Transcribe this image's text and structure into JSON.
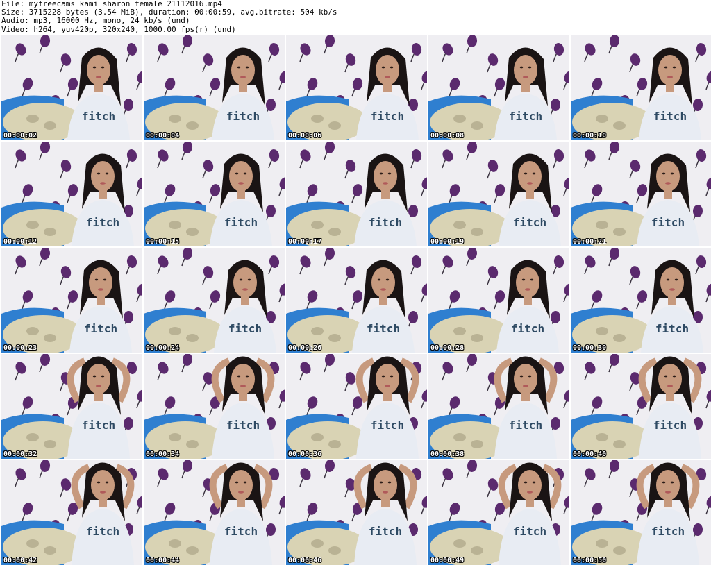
{
  "header": {
    "file": "File: myfreecams_kami_sharon_female_21112016.mp4",
    "size": "Size: 3715228 bytes (3.54 MiB), duration: 00:00:59, avg.bitrate: 504 kb/s",
    "audio": "Audio: mp3, 16000 Hz, mono, 24 kb/s (und)",
    "video": "Video: h264, yuv420p, 320x240, 1000.00 fps(r) (und)"
  },
  "thumbnails": [
    {
      "timestamp": "00:00:02"
    },
    {
      "timestamp": "00:00:04"
    },
    {
      "timestamp": "00:00:06"
    },
    {
      "timestamp": "00:00:08"
    },
    {
      "timestamp": "00:00:10"
    },
    {
      "timestamp": "00:00:12"
    },
    {
      "timestamp": "00:00:15"
    },
    {
      "timestamp": "00:00:17"
    },
    {
      "timestamp": "00:00:19"
    },
    {
      "timestamp": "00:00:21"
    },
    {
      "timestamp": "00:00:23"
    },
    {
      "timestamp": "00:00:24"
    },
    {
      "timestamp": "00:00:26"
    },
    {
      "timestamp": "00:00:28"
    },
    {
      "timestamp": "00:00:30"
    },
    {
      "timestamp": "00:00:32"
    },
    {
      "timestamp": "00:00:34"
    },
    {
      "timestamp": "00:00:36"
    },
    {
      "timestamp": "00:00:38"
    },
    {
      "timestamp": "00:00:40"
    },
    {
      "timestamp": "00:00:42"
    },
    {
      "timestamp": "00:00:44"
    },
    {
      "timestamp": "00:00:46"
    },
    {
      "timestamp": "00:00:49"
    },
    {
      "timestamp": "00:00:50"
    }
  ],
  "colors": {
    "wallpaper": "#efeef2",
    "leaf": "#5b2a6e",
    "stem": "#3a3340",
    "blanket": "#2f7fd0",
    "cushion": "#d9d3b4",
    "shirt": "#e8ecf3",
    "shirt_print": "#2e4a63",
    "skin": "#c79a7e",
    "hair": "#1a1414"
  }
}
